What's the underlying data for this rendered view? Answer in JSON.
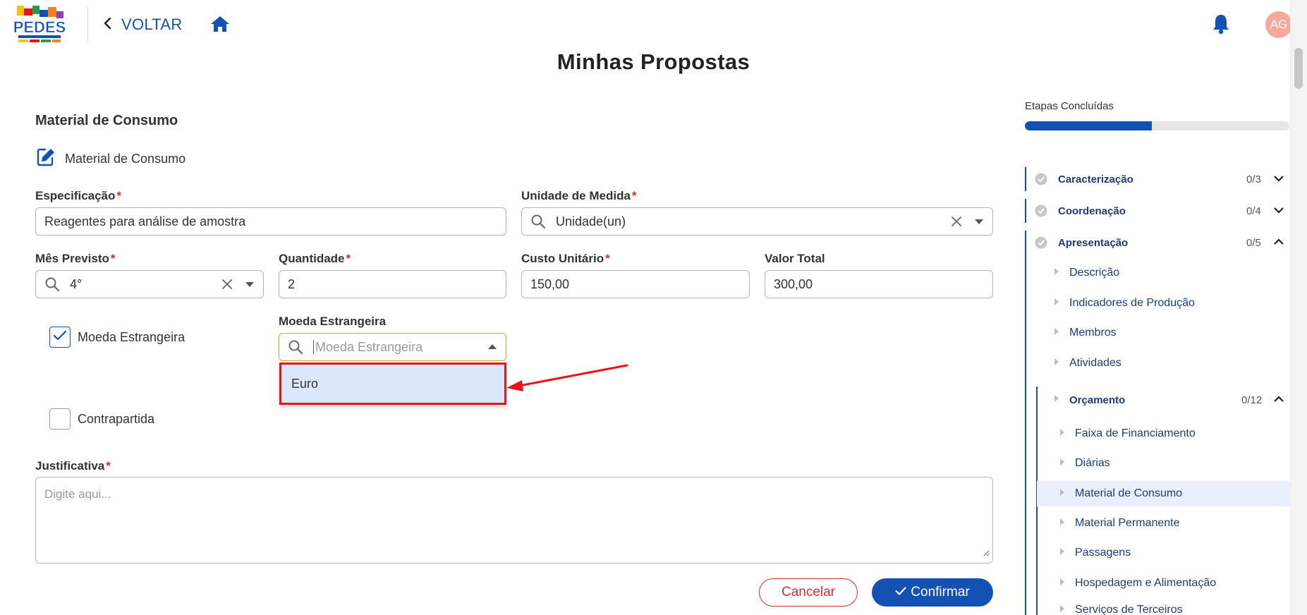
{
  "header": {
    "back_label": "VOLTAR",
    "avatar_initials": "AG",
    "logo_text": "PEDES"
  },
  "page_title": "Minhas Propostas",
  "form": {
    "section_title": "Material de Consumo",
    "subsection_label": "Material de Consumo",
    "especificacao": {
      "label": "Especificação",
      "value": "Reagentes para análise de amostra"
    },
    "unidade": {
      "label": "Unidade de Medida",
      "value": "Unidade(un)"
    },
    "mes": {
      "label": "Mês Previsto",
      "value": "4°"
    },
    "quantidade": {
      "label": "Quantidade",
      "value": "2"
    },
    "custo": {
      "label": "Custo Unitário",
      "value": "150,00"
    },
    "valor_total": {
      "label": "Valor Total",
      "value": "300,00"
    },
    "moeda_checkbox": {
      "label": "Moeda Estrangeira",
      "checked": true
    },
    "moeda_select": {
      "label": "Moeda Estrangeira",
      "placeholder": "Moeda Estrangeira",
      "options": [
        "Euro"
      ]
    },
    "contrapartida": {
      "label": "Contrapartida",
      "checked": false
    },
    "justificativa": {
      "label": "Justificativa",
      "placeholder": "Digite aqui..."
    },
    "required_mark": "*",
    "cancel_label": "Cancelar",
    "confirm_label": "Confirmar"
  },
  "sidebar": {
    "progress_label": "Etapas Concluídas",
    "progress_fraction": 0.48,
    "sections": [
      {
        "label": "Caracterização",
        "count": "0/3",
        "expanded": false
      },
      {
        "label": "Coordenação",
        "count": "0/4",
        "expanded": false
      },
      {
        "label": "Apresentação",
        "count": "0/5",
        "expanded": true
      }
    ],
    "apresentacao_items": [
      "Descrição",
      "Indicadores de Produção",
      "Membros",
      "Atividades"
    ],
    "orcamento": {
      "label": "Orçamento",
      "count": "0/12"
    },
    "orcamento_items": [
      "Faixa de Financiamento",
      "Diárias",
      "Material de Consumo",
      "Material Permanente",
      "Passagens",
      "Hospedagem e Alimentação",
      "Serviços de Terceiros"
    ],
    "active_item": "Material de Consumo"
  },
  "colors": {
    "primary": "#1351b4",
    "danger": "#d32f2f",
    "highlight": "#e8141c",
    "focus": "#d9a12c"
  }
}
